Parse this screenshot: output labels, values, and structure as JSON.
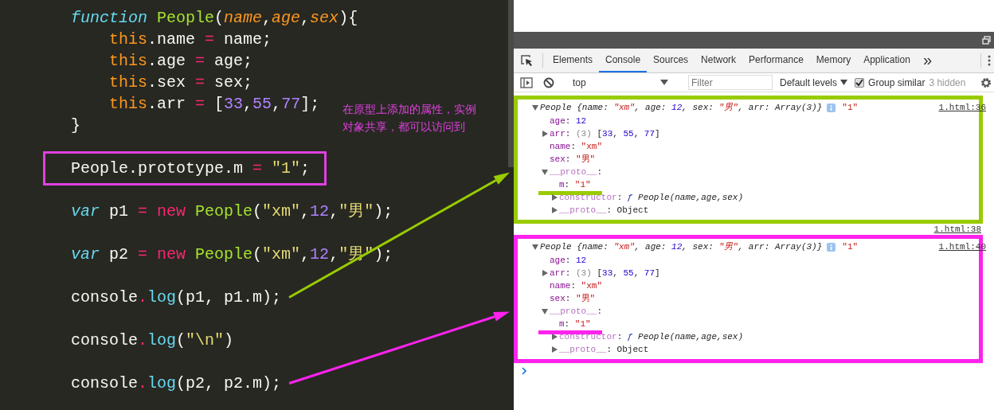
{
  "editor": {
    "blocks": [
      [
        {
          "tokens": [
            {
              "kind": "keyword",
              "text": "function"
            },
            {
              "kind": "name",
              "text": " People"
            },
            {
              "kind": "plain",
              "text": "("
            },
            {
              "kind": "param",
              "text": "name"
            },
            {
              "kind": "plain",
              "text": ","
            },
            {
              "kind": "param",
              "text": "age"
            },
            {
              "kind": "plain",
              "text": ","
            },
            {
              "kind": "param",
              "text": "sex"
            },
            {
              "kind": "plain",
              "text": "){"
            }
          ],
          "children": [
            {
              "tokens": [
                {
                  "kind": "this",
                  "text": "this"
                },
                {
                  "kind": "plain",
                  "text": ".name "
                },
                {
                  "kind": "op",
                  "text": "="
                },
                {
                  "kind": "plain",
                  "text": " name;"
                }
              ]
            },
            {
              "tokens": [
                {
                  "kind": "this",
                  "text": "this"
                },
                {
                  "kind": "plain",
                  "text": ".age "
                },
                {
                  "kind": "op",
                  "text": "="
                },
                {
                  "kind": "plain",
                  "text": " age;"
                }
              ]
            },
            {
              "tokens": [
                {
                  "kind": "this",
                  "text": "this"
                },
                {
                  "kind": "plain",
                  "text": ".sex "
                },
                {
                  "kind": "op",
                  "text": "="
                },
                {
                  "kind": "plain",
                  "text": " sex;"
                }
              ]
            },
            {
              "tokens": [
                {
                  "kind": "this",
                  "text": "this"
                },
                {
                  "kind": "plain",
                  "text": ".arr "
                },
                {
                  "kind": "op",
                  "text": "="
                },
                {
                  "kind": "plain",
                  "text": " ["
                },
                {
                  "kind": "number",
                  "text": "33"
                },
                {
                  "kind": "plain",
                  "text": ","
                },
                {
                  "kind": "number",
                  "text": "55"
                },
                {
                  "kind": "plain",
                  "text": ","
                },
                {
                  "kind": "number",
                  "text": "77"
                },
                {
                  "kind": "plain",
                  "text": "];"
                }
              ]
            }
          ]
        },
        {
          "tokens": [
            {
              "kind": "plain",
              "text": "}"
            }
          ]
        }
      ],
      [
        {
          "highlight": true,
          "tokens": [
            {
              "kind": "plain",
              "text": "People.prototype.m "
            },
            {
              "kind": "op",
              "text": "= "
            },
            {
              "kind": "string",
              "text": "\"1\""
            },
            {
              "kind": "plain",
              "text": ";"
            }
          ]
        }
      ],
      [
        {
          "tokens": [
            {
              "kind": "keyword",
              "text": "var"
            },
            {
              "kind": "plain",
              "text": " p1 "
            },
            {
              "kind": "op",
              "text": "= new "
            },
            {
              "kind": "name",
              "text": "People"
            },
            {
              "kind": "plain",
              "text": "("
            },
            {
              "kind": "string",
              "text": "\"xm\""
            },
            {
              "kind": "plain",
              "text": ","
            },
            {
              "kind": "number",
              "text": "12"
            },
            {
              "kind": "plain",
              "text": ","
            },
            {
              "kind": "string",
              "text": "\"男\""
            },
            {
              "kind": "plain",
              "text": ");"
            }
          ]
        }
      ],
      [
        {
          "tokens": [
            {
              "kind": "keyword",
              "text": "var"
            },
            {
              "kind": "plain",
              "text": " p2 "
            },
            {
              "kind": "op",
              "text": "= new "
            },
            {
              "kind": "name",
              "text": "People"
            },
            {
              "kind": "plain",
              "text": "("
            },
            {
              "kind": "string",
              "text": "\"xm\""
            },
            {
              "kind": "plain",
              "text": ","
            },
            {
              "kind": "number",
              "text": "12"
            },
            {
              "kind": "plain",
              "text": ","
            },
            {
              "kind": "string",
              "text": "\"男\""
            },
            {
              "kind": "plain",
              "text": ");"
            }
          ]
        }
      ],
      [
        {
          "arrow": true,
          "tokens": [
            {
              "kind": "plain",
              "text": "console"
            },
            {
              "kind": "op",
              "text": "."
            },
            {
              "kind": "method",
              "text": "log"
            },
            {
              "kind": "plain",
              "text": "(p1, p1.m);"
            }
          ]
        }
      ],
      [
        {
          "tokens": [
            {
              "kind": "plain",
              "text": "console"
            },
            {
              "kind": "op",
              "text": "."
            },
            {
              "kind": "method",
              "text": "log"
            },
            {
              "kind": "plain",
              "text": "("
            },
            {
              "kind": "string",
              "text": "\"\\n\""
            },
            {
              "kind": "plain",
              "text": ")"
            }
          ]
        }
      ],
      [
        {
          "arrow": true,
          "tokens": [
            {
              "kind": "plain",
              "text": "console"
            },
            {
              "kind": "op",
              "text": "."
            },
            {
              "kind": "method",
              "text": "log"
            },
            {
              "kind": "plain",
              "text": "(p2, p2.m);"
            }
          ]
        }
      ]
    ],
    "note": "在原型上添加的属性，实例对象共享，都可以访问到"
  },
  "devtools": {
    "tabs": [
      {
        "label": "Elements",
        "selected": false
      },
      {
        "label": "Console",
        "selected": true
      },
      {
        "label": "Sources",
        "selected": false
      },
      {
        "label": "Network",
        "selected": false
      },
      {
        "label": "Performance",
        "selected": false
      },
      {
        "label": "Memory",
        "selected": false
      },
      {
        "label": "Application",
        "selected": false
      }
    ],
    "more_tabs": "»",
    "toolbar": {
      "context": "top",
      "filter_placeholder": "Filter",
      "levels": "Default levels",
      "group_similar": {
        "label": "Group similar",
        "checked": true
      },
      "hidden": "3 hidden"
    },
    "console": [
      {
        "kind": "object",
        "color": "#99cc00",
        "source": "1.html:36",
        "expanded": true,
        "summary": [
          {
            "kind": "plain",
            "text": "People {name: "
          },
          {
            "kind": "string",
            "text": "\"xm\""
          },
          {
            "kind": "plain",
            "text": ", age: "
          },
          {
            "kind": "number",
            "text": "12"
          },
          {
            "kind": "plain",
            "text": ", sex: "
          },
          {
            "kind": "string",
            "text": "\"男\""
          },
          {
            "kind": "plain",
            "text": ", arr: Array(3)}"
          }
        ],
        "extra": "\"1\"",
        "children": [
          {
            "key": "age",
            "kind": "own",
            "value": [
              {
                "kind": "plain",
                "text": ": "
              },
              {
                "kind": "number",
                "text": "12"
              }
            ]
          },
          {
            "key": "arr",
            "kind": "own",
            "expanded": false,
            "value": [
              {
                "kind": "plain",
                "text": ": "
              },
              {
                "kind": "muted",
                "text": "(3)"
              },
              {
                "kind": "plain",
                "text": " ["
              },
              {
                "kind": "number",
                "text": "33"
              },
              {
                "kind": "plain",
                "text": ", "
              },
              {
                "kind": "number",
                "text": "55"
              },
              {
                "kind": "plain",
                "text": ", "
              },
              {
                "kind": "number",
                "text": "77"
              },
              {
                "kind": "plain",
                "text": "]"
              }
            ]
          },
          {
            "key": "name",
            "kind": "own",
            "value": [
              {
                "kind": "plain",
                "text": ": "
              },
              {
                "kind": "string",
                "text": "\"xm\""
              }
            ]
          },
          {
            "key": "sex",
            "kind": "own",
            "value": [
              {
                "kind": "plain",
                "text": ": "
              },
              {
                "kind": "string",
                "text": "\"男\""
              }
            ]
          },
          {
            "key": "__proto__",
            "kind": "internal",
            "expanded": true,
            "value": [
              {
                "kind": "plain",
                "text": ":"
              }
            ],
            "children": [
              {
                "key": "m",
                "kind": "own",
                "underline": true,
                "value": [
                  {
                    "kind": "plain",
                    "text": ": "
                  },
                  {
                    "kind": "string",
                    "text": "\"1\""
                  }
                ]
              },
              {
                "key": "constructor",
                "kind": "internal",
                "expanded": false,
                "value": [
                  {
                    "kind": "plain",
                    "text": ": "
                  },
                  {
                    "kind": "func",
                    "text": "ƒ"
                  },
                  {
                    "kind": "italic",
                    "text": " People(name,age,sex)"
                  }
                ]
              },
              {
                "key": "__proto__",
                "kind": "internal",
                "expanded": false,
                "value": [
                  {
                    "kind": "plain",
                    "text": ": Object"
                  }
                ]
              }
            ]
          }
        ]
      },
      {
        "kind": "blank",
        "source": "1.html:38"
      },
      {
        "kind": "object",
        "color": "#ff22ee",
        "source": "1.html:40",
        "expanded": true,
        "summary": [
          {
            "kind": "plain",
            "text": "People {name: "
          },
          {
            "kind": "string",
            "text": "\"xm\""
          },
          {
            "kind": "plain",
            "text": ", age: "
          },
          {
            "kind": "number",
            "text": "12"
          },
          {
            "kind": "plain",
            "text": ", sex: "
          },
          {
            "kind": "string",
            "text": "\"男\""
          },
          {
            "kind": "plain",
            "text": ", arr: Array(3)}"
          }
        ],
        "extra": "\"1\"",
        "children": [
          {
            "key": "age",
            "kind": "own",
            "value": [
              {
                "kind": "plain",
                "text": ": "
              },
              {
                "kind": "number",
                "text": "12"
              }
            ]
          },
          {
            "key": "arr",
            "kind": "own",
            "expanded": false,
            "value": [
              {
                "kind": "plain",
                "text": ": "
              },
              {
                "kind": "muted",
                "text": "(3)"
              },
              {
                "kind": "plain",
                "text": " ["
              },
              {
                "kind": "number",
                "text": "33"
              },
              {
                "kind": "plain",
                "text": ", "
              },
              {
                "kind": "number",
                "text": "55"
              },
              {
                "kind": "plain",
                "text": ", "
              },
              {
                "kind": "number",
                "text": "77"
              },
              {
                "kind": "plain",
                "text": "]"
              }
            ]
          },
          {
            "key": "name",
            "kind": "own",
            "value": [
              {
                "kind": "plain",
                "text": ": "
              },
              {
                "kind": "string",
                "text": "\"xm\""
              }
            ]
          },
          {
            "key": "sex",
            "kind": "own",
            "value": [
              {
                "kind": "plain",
                "text": ": "
              },
              {
                "kind": "string",
                "text": "\"男\""
              }
            ]
          },
          {
            "key": "__proto__",
            "kind": "internal",
            "expanded": true,
            "value": [
              {
                "kind": "plain",
                "text": ":"
              }
            ],
            "children": [
              {
                "key": "m",
                "kind": "own",
                "underline": true,
                "value": [
                  {
                    "kind": "plain",
                    "text": ": "
                  },
                  {
                    "kind": "string",
                    "text": "\"1\""
                  }
                ]
              },
              {
                "key": "constructor",
                "kind": "internal",
                "expanded": false,
                "value": [
                  {
                    "kind": "plain",
                    "text": ": "
                  },
                  {
                    "kind": "func",
                    "text": "ƒ"
                  },
                  {
                    "kind": "italic",
                    "text": " People(name,age,sex)"
                  }
                ]
              },
              {
                "key": "__proto__",
                "kind": "internal",
                "expanded": false,
                "value": [
                  {
                    "kind": "plain",
                    "text": ": Object"
                  }
                ]
              }
            ]
          }
        ]
      }
    ]
  }
}
